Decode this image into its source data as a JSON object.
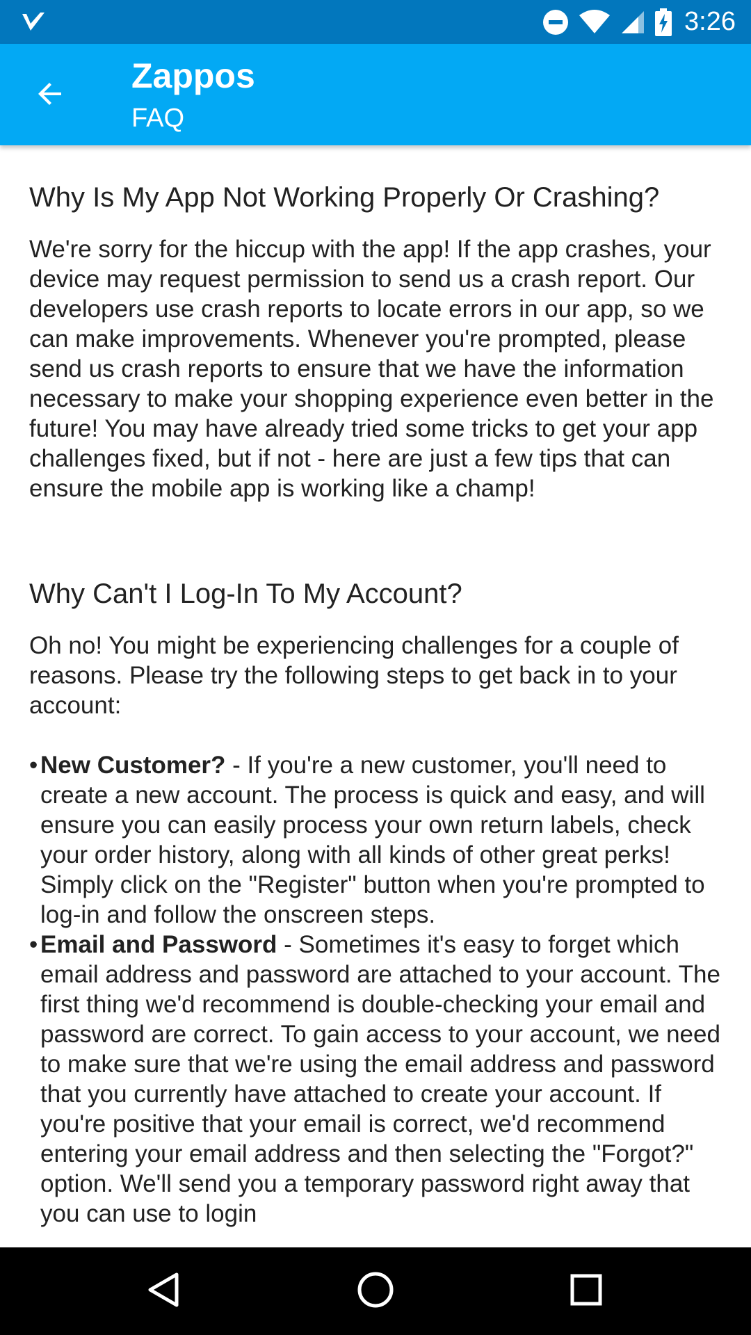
{
  "status_bar": {
    "time": "3:26",
    "icons": [
      "check-notification-icon",
      "do-not-disturb-icon",
      "wifi-icon",
      "cellular-signal-icon",
      "battery-charging-icon"
    ]
  },
  "app_bar": {
    "title": "Zappos",
    "subtitle": "FAQ",
    "background_color": "#03a9f4",
    "status_color": "#0277bd"
  },
  "faq": [
    {
      "question": "Why Is My App Not Working Properly Or Crashing?",
      "answer": "We're sorry for the hiccup with the app! If the app crashes, your device may request permission to send us a crash report. Our developers use crash reports to locate errors in our app, so we can make improvements. Whenever you're prompted, please send us crash reports to ensure that we have the information necessary to make your shopping experience even better in the future! You may have already tried some tricks to get your app challenges fixed, but if not - here are just a few tips that can ensure the mobile app is working like a champ!"
    },
    {
      "question": "Why Can't I Log-In To My Account?",
      "intro": "Oh no! You might be experiencing challenges for a couple of reasons. Please try the following steps to get back in to your account:",
      "bullets": [
        {
          "bold": "New Customer?",
          "text": " - If you're a new customer, you'll need to create a new account. The process is quick and easy, and will ensure you can easily process your own return labels, check your order history, along with all kinds of other great perks! Simply click on the \"Register\" button when you're prompted to log-in and follow the onscreen steps."
        },
        {
          "bold": "Email and Password",
          "text": " - Sometimes it's easy to forget which email address and password are attached to your account. The first thing we'd recommend is double-checking your email and password are correct. To gain access to your account, we need to make sure that we're using the email address and password that you currently have attached to create your account. If you're positive that your email is correct, we'd recommend entering your email address and then selecting the \"Forgot?\" option. We'll send you a temporary password right away that you can use to login"
        }
      ]
    }
  ],
  "bullet_char": "•",
  "nav_bar": {
    "icons": [
      "back-triangle-icon",
      "home-circle-icon",
      "recents-square-icon"
    ]
  }
}
